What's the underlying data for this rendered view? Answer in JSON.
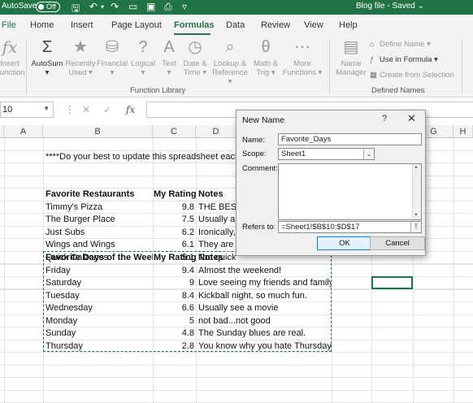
{
  "titlebar": {
    "autosave_label": "AutoSave",
    "autosave_state": "Off",
    "title": "Blog file - Saved",
    "title_caret": "⌄"
  },
  "tabs": [
    "File",
    "Home",
    "Insert",
    "Page Layout",
    "Formulas",
    "Data",
    "Review",
    "View",
    "Help"
  ],
  "active_tab": "Formulas",
  "ribbon": {
    "insert_function": [
      "Insert",
      "Function"
    ],
    "autosum": [
      "AutoSum",
      "▾"
    ],
    "recently_used": [
      "Recently",
      "Used ▾"
    ],
    "financial": [
      "Financial",
      "▾"
    ],
    "logical": [
      "Logical",
      "▾"
    ],
    "text": [
      "Text",
      "▾"
    ],
    "date_time": [
      "Date &",
      "Time ▾"
    ],
    "lookup": [
      "Lookup &",
      "Reference ▾"
    ],
    "math": [
      "Math &",
      "Trig ▾"
    ],
    "more": [
      "More",
      "Functions ▾"
    ],
    "function_library_label": "Function Library",
    "name_manager": [
      "Name",
      "Manager"
    ],
    "define_name": "Define Name ▾",
    "use_in_formula": "Use in Formula ▾",
    "create_from_selection": "Create from Selection",
    "defined_names_label": "Defined Names"
  },
  "formula_bar": {
    "name_box": "10",
    "cancel": "✕",
    "enter": "✓",
    "fx": "fx"
  },
  "columns": [
    "A",
    "B",
    "C",
    "D",
    "G",
    "H"
  ],
  "sheet": {
    "r1": "****Do your best to update this spreadsheet each",
    "restaurants_header": [
      "Favorite Restaurants",
      "My Rating",
      "Notes"
    ],
    "restaurants": [
      {
        "name": "Timmy's Pizza",
        "rating": "9.8",
        "note": "THE BEST!"
      },
      {
        "name": "The Burger Place",
        "rating": "7.5",
        "note": "Usually a g"
      },
      {
        "name": "Just Subs",
        "rating": "6.2",
        "note": "Ironically,"
      },
      {
        "name": "Wings and Wings",
        "rating": "6.1",
        "note": "They are d"
      },
      {
        "name": "Quick Calzones",
        "rating": "5.1",
        "note": "Too quick."
      }
    ],
    "days_header": [
      "Favorite Days of the Week",
      "My Rating",
      "Notes"
    ],
    "days": [
      {
        "name": "Friday",
        "rating": "9.4",
        "note": "Almost the weekend!"
      },
      {
        "name": "Saturday",
        "rating": "9",
        "note": "Love seeing my friends and family"
      },
      {
        "name": "Tuesday",
        "rating": "8.4",
        "note": "Kickball night, so much fun."
      },
      {
        "name": "Wednesday",
        "rating": "6.6",
        "note": "Usually see a movie"
      },
      {
        "name": "Monday",
        "rating": "5",
        "note": "not bad...not good"
      },
      {
        "name": "Sunday",
        "rating": "4.8",
        "note": "The Sunday blues are real."
      },
      {
        "name": "Thursday",
        "rating": "2.8",
        "note": "You know why you hate Thursdays"
      }
    ]
  },
  "dialog": {
    "title": "New Name",
    "help": "?",
    "close": "✕",
    "name_label": "Name:",
    "name_value": "Favorite_Days",
    "scope_label": "Scope:",
    "scope_value": "Sheet1",
    "comment_label": "Comment:",
    "refers_label": "Refers to:",
    "refers_value": "=Sheet1!$B$10:$D$17",
    "ok": "OK",
    "cancel": "Cancel"
  },
  "colors": {
    "accent": "#217346"
  }
}
